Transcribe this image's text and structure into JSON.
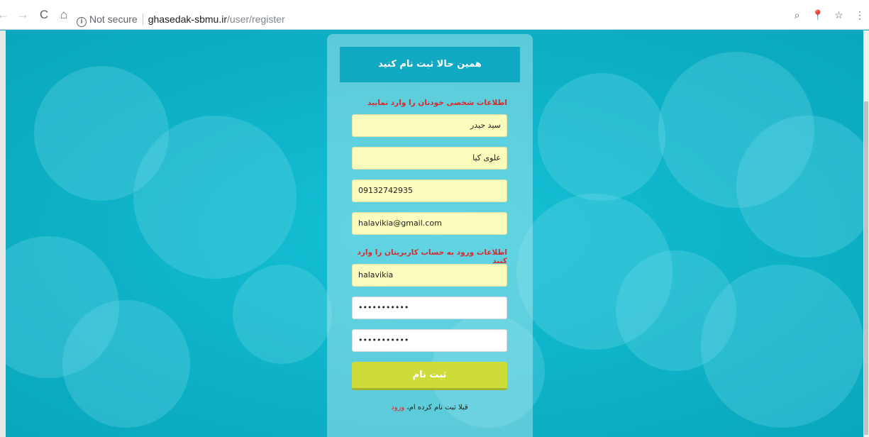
{
  "browser": {
    "security_label": "Not secure",
    "url_host": "ghasedak-sbmu.ir",
    "url_path": "/user/register",
    "nav": {
      "back": "←",
      "forward": "→",
      "reload": "C",
      "home": "⌂"
    },
    "icons": [
      "zoom-icon",
      "extension-icon",
      "star-icon",
      "menu-icon"
    ]
  },
  "card": {
    "title": "همین حالا ثبت نام کنید",
    "personal_info_label": "اطلاعات شخصی خودتان را وارد نمایید",
    "first_name": "سید حیدر",
    "last_name": "علوی کیا",
    "phone": "09132742935",
    "email": "halavikia@gmail.com",
    "account_info_label": "اطلاعات ورود به حساب کاربریتان را وارد کنید",
    "username": "halavikia",
    "password": "•••••••••••",
    "password_confirm": "•••••••••••",
    "submit_label": "ثبت نام",
    "login_prompt": "قبلا ثبت نام کرده ام،",
    "login_link": "ورود"
  },
  "colors": {
    "background": "#10b5c9",
    "header": "#10a8c3",
    "field_fill": "#fbfcbb",
    "label_red": "#d9292d",
    "submit": "#cddc39"
  }
}
